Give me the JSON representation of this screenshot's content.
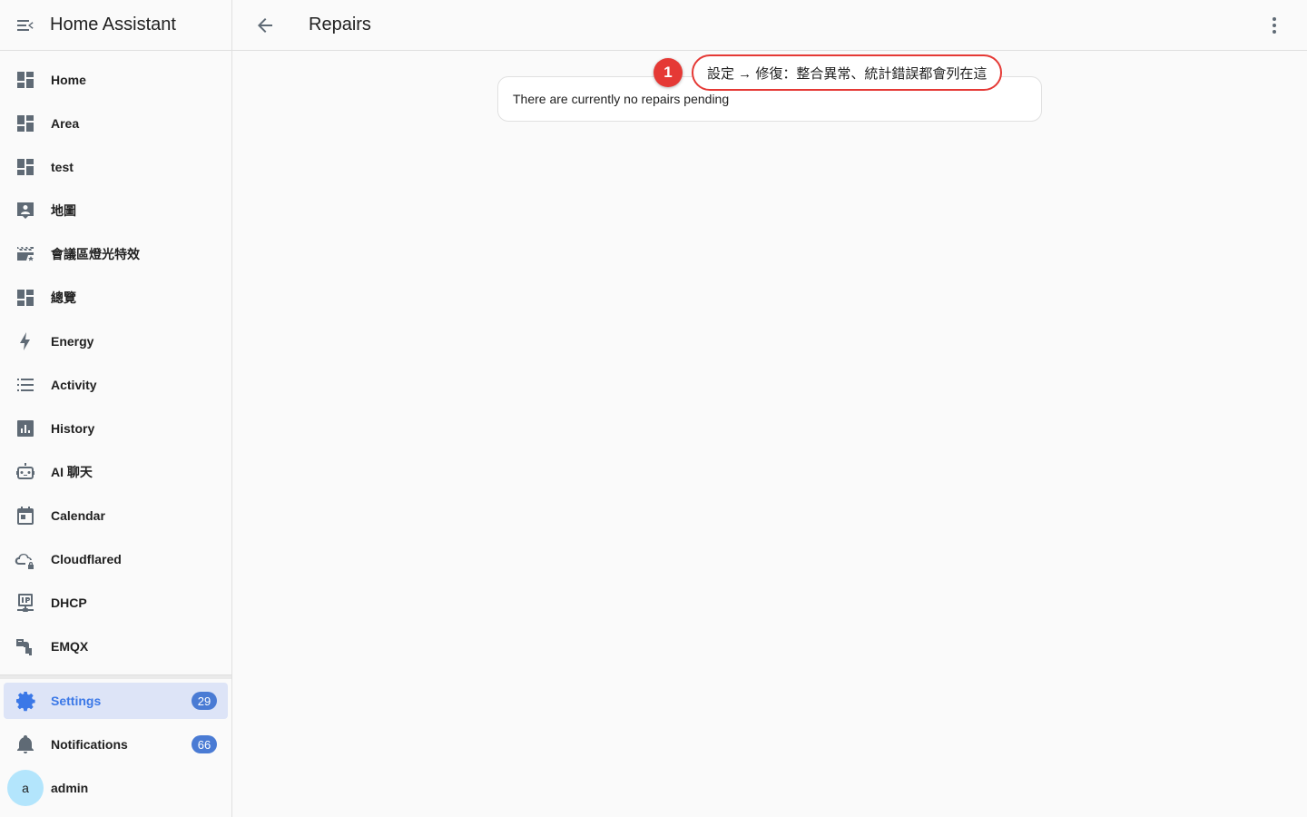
{
  "sidebar": {
    "app_title": "Home Assistant",
    "items": [
      {
        "label": "Home",
        "icon": "dashboard-icon"
      },
      {
        "label": "Area",
        "icon": "dashboard-icon"
      },
      {
        "label": "test",
        "icon": "dashboard-icon"
      },
      {
        "label": "地圖",
        "icon": "map-account-icon"
      },
      {
        "label": "會議區燈光特效",
        "icon": "movie-star-icon"
      },
      {
        "label": "總覽",
        "icon": "dashboard-icon"
      },
      {
        "label": "Energy",
        "icon": "lightning-icon"
      },
      {
        "label": "Activity",
        "icon": "format-list-icon"
      },
      {
        "label": "History",
        "icon": "chart-box-icon"
      },
      {
        "label": "AI 聊天",
        "icon": "robot-icon"
      },
      {
        "label": "Calendar",
        "icon": "calendar-icon"
      },
      {
        "label": "Cloudflared",
        "icon": "cloud-lock-icon"
      },
      {
        "label": "DHCP",
        "icon": "ip-network-icon"
      },
      {
        "label": "EMQX",
        "icon": "pipe-icon"
      }
    ],
    "settings": {
      "label": "Settings",
      "badge": "29"
    },
    "notifications": {
      "label": "Notifications",
      "badge": "66"
    },
    "user": {
      "initial": "a",
      "label": "admin"
    }
  },
  "topbar": {
    "title": "Repairs"
  },
  "main": {
    "empty_message": "There are currently no repairs pending"
  },
  "annotation": {
    "number": "1",
    "text": "設定 → 修復：整合異常、統計錯誤都會列在這"
  },
  "colors": {
    "accent": "#3b78e7",
    "badge": "#4a7bd4",
    "annotation": "#e53935"
  }
}
